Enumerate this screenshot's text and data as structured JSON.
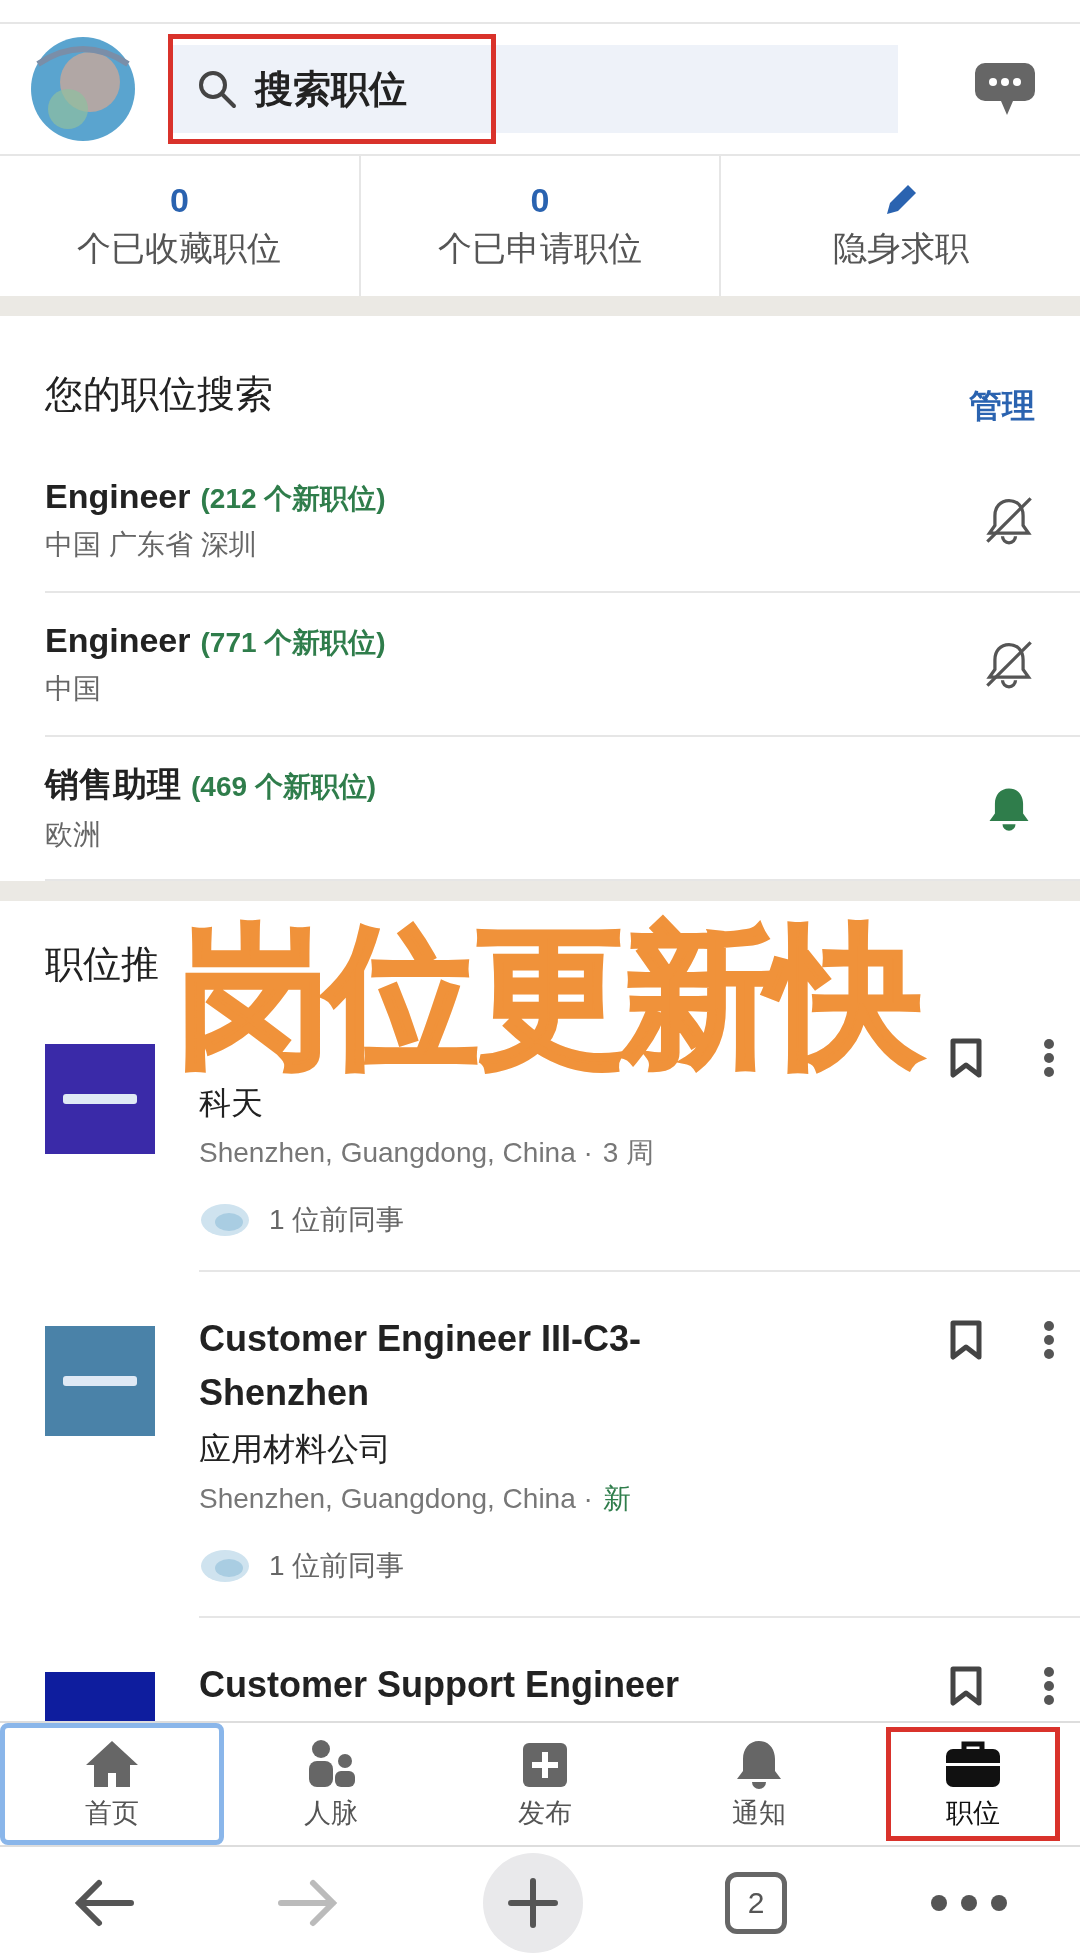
{
  "header": {
    "search": {
      "placeholder": "搜索职位",
      "color": "#d9322b"
    }
  },
  "stats": [
    {
      "kind": "count",
      "value": "0",
      "label": "个已收藏职位"
    },
    {
      "kind": "count",
      "value": "0",
      "label": "个已申请职位"
    },
    {
      "kind": "edit",
      "label": "隐身求职"
    }
  ],
  "saved_searches": {
    "title": "您的职位搜索",
    "action": "管理",
    "items": [
      {
        "title": "Engineer",
        "count": "(212 个新职位)",
        "location": "中国 广东省 深圳",
        "alert_on": false
      },
      {
        "title": "Engineer",
        "count": "(771 个新职位)",
        "location": "中国",
        "alert_on": false
      },
      {
        "title": "销售助理",
        "count": "(469 个新职位)",
        "location": "欧洲",
        "alert_on": true
      }
    ]
  },
  "recommendations": {
    "title": "职位推",
    "jobs": [
      {
        "color": "#3a2aa8",
        "company": "科天",
        "location": "Shenzhen, Guangdong, China ·",
        "age": "3 周",
        "age_is_new": false,
        "connections": "1 位前同事"
      },
      {
        "color": "#4a82a8",
        "title": "Customer Engineer III-C3-Shenzhen",
        "company": "应用材料公司",
        "location": "Shenzhen, Guangdong, China ·",
        "age": "新",
        "age_is_new": true,
        "connections": "1 位前同事"
      },
      {
        "color": "#0e1d9e",
        "title": "Customer Support Engineer"
      }
    ]
  },
  "overlay_caption": "岗位更新快",
  "bottom_nav": [
    {
      "kind": "home",
      "label": "首页",
      "selected": false,
      "color": "#8ab6ea"
    },
    {
      "kind": "people",
      "label": "人脉",
      "selected": false
    },
    {
      "kind": "post",
      "label": "发布",
      "selected": false
    },
    {
      "kind": "bell",
      "label": "通知",
      "selected": false
    },
    {
      "kind": "briefcase",
      "label": "职位",
      "selected": true,
      "color": "#d9322b"
    }
  ],
  "browser_bar": {
    "tab_count": "2"
  }
}
